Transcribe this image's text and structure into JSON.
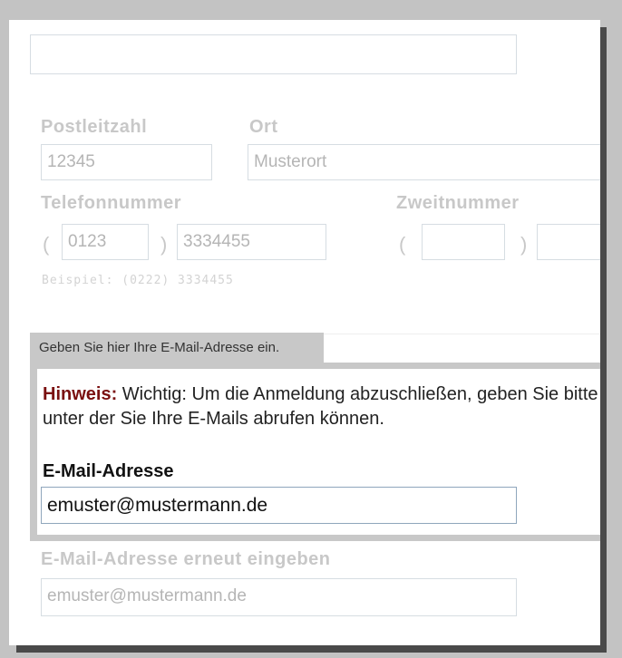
{
  "form": {
    "top_field_value": "",
    "postal": {
      "label": "Postleitzahl",
      "value": "12345"
    },
    "city": {
      "label": "Ort",
      "value": "Musterort"
    },
    "phone": {
      "label": "Telefonnummer",
      "area_code": "0123",
      "number": "3334455",
      "example": "Beispiel: (0222) 3334455"
    },
    "second_phone": {
      "label": "Zweitnummer",
      "area_code": "",
      "number": ""
    },
    "email_section": {
      "tab_label": "Geben Sie hier Ihre E-Mail-Adresse ein.",
      "hint_label": "Hinweis:",
      "hint_text": " Wichtig: Um die Anmeldung abzuschließen, geben Sie bitte eine E-Mail-Adresse an,",
      "hint_text_line2": "unter der Sie Ihre E-Mails abrufen können.",
      "email_label": "E-Mail-Adresse",
      "email_value": "emuster@mustermann.de"
    },
    "confirm_email": {
      "label": "E-Mail-Adresse erneut eingeben",
      "value": "emuster@mustermann.de"
    },
    "paren_open": "(",
    "paren_close": ")"
  }
}
